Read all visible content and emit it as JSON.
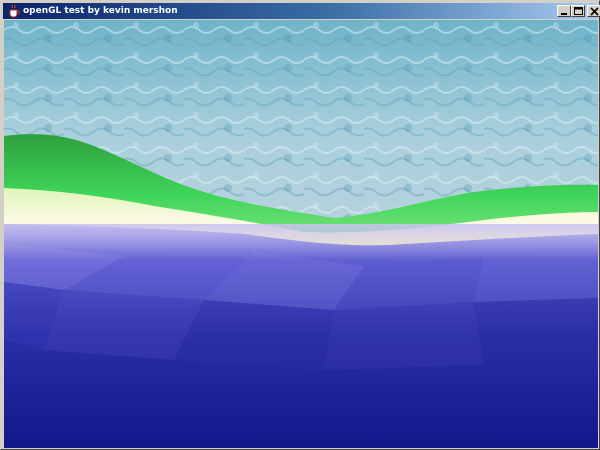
{
  "window": {
    "title": "openGL test by kevin mershon",
    "icon": "java-cup-icon",
    "controls": [
      "minimize",
      "maximize",
      "close"
    ]
  },
  "scene": {
    "description_colors": {
      "sky_water": "#8fc7d8",
      "grass": "#2fbf4a",
      "sand": "#f2f0c0",
      "sea_near": "#1a1f8a",
      "sea_far": "#6a6ad8"
    }
  }
}
